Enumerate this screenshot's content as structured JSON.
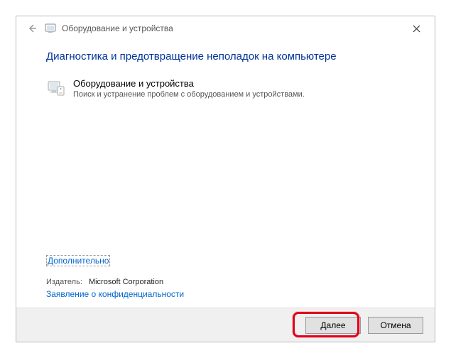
{
  "titlebar": {
    "title": "Оборудование и устройства"
  },
  "content": {
    "heading": "Диагностика и предотвращение неполадок на компьютере",
    "item": {
      "title": "Оборудование и устройства",
      "description": "Поиск и устранение проблем с оборудованием и устройствами."
    },
    "advanced_link": "Дополнительно",
    "publisher_label": "Издатель:",
    "publisher_value": "Microsoft Corporation",
    "privacy_link": "Заявление о конфиденциальности"
  },
  "footer": {
    "next_label": "Далее",
    "cancel_label": "Отмена"
  }
}
